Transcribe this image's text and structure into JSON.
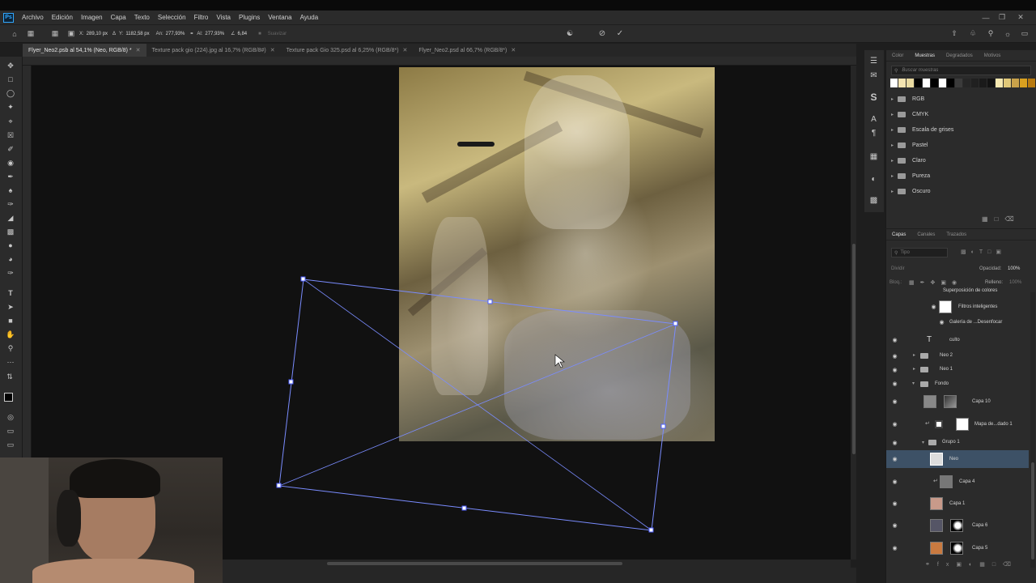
{
  "app": {
    "logo": "Ps"
  },
  "menu": [
    "Archivo",
    "Edición",
    "Imagen",
    "Capa",
    "Texto",
    "Selección",
    "Filtro",
    "Vista",
    "Plugins",
    "Ventana",
    "Ayuda"
  ],
  "options": {
    "x_label": "X:",
    "x_value": "289,10 px",
    "y_label": "Y:",
    "y_value": "1182,58 px",
    "w_label": "An:",
    "w_value": "277,93%",
    "h_label": "Al:",
    "h_value": "277,93%",
    "angle_value": "6,84",
    "smooth_label": "Suavizar"
  },
  "tabs": [
    {
      "label": "Flyer_Neo2.psb al 54,1% (Neo, RGB/8) *",
      "active": true
    },
    {
      "label": "Texture pack gio (224).jpg al 16,7% (RGB/8#)",
      "active": false
    },
    {
      "label": "Texture pack Gio 325.psd al 6,25% (RGB/8*)",
      "active": false
    },
    {
      "label": "Flyer_Neo2.psd al 66,7% (RGB/8*)",
      "active": false
    }
  ],
  "swatches_panel": {
    "tabs": [
      "Color",
      "Muestras",
      "Degradados",
      "Motivos"
    ],
    "active_tab": "Muestras",
    "search_placeholder": "Buscar muestras",
    "colors": [
      "#ffffff",
      "#f3e3b0",
      "#e8d9a0",
      "#000000",
      "#ffffff",
      "#000000",
      "#ffffff",
      "#000000",
      "#3b3b3b",
      "#262626",
      "#202020",
      "#1a1a1a",
      "#121212",
      "#f5e8b0",
      "#e0c878",
      "#c9a24a",
      "#d9a020",
      "#b87a10"
    ],
    "folders": [
      "RGB",
      "CMYK",
      "Escala de grises",
      "Pastel",
      "Claro",
      "Pureza",
      "Oscuro"
    ]
  },
  "layers_panel": {
    "tabs": [
      "Capas",
      "Canales",
      "Trazados"
    ],
    "active_tab": "Capas",
    "filter_placeholder": "Tipo",
    "blend_mode": "Dividir",
    "opacity_label": "Opacidad:",
    "opacity_value": "100%",
    "lock_label": "Bloq.:",
    "fill_label": "Relleno:",
    "fill_value": "100%",
    "layers": [
      {
        "name": "Superposición de colores"
      },
      {
        "name": "Filtros inteligentes"
      },
      {
        "name": "Galería de ...Desenfocar"
      },
      {
        "name": "culto"
      },
      {
        "name": "Neo 2"
      },
      {
        "name": "Neo 1"
      },
      {
        "name": "Fondo"
      },
      {
        "name": "Capa 10"
      },
      {
        "name": "Mapa de...dado 1"
      },
      {
        "name": "Grupo 1"
      },
      {
        "name": "Neo"
      },
      {
        "name": "Capa 4"
      },
      {
        "name": "Capa 1"
      },
      {
        "name": "Capa 6"
      },
      {
        "name": "Capa 5"
      }
    ]
  }
}
